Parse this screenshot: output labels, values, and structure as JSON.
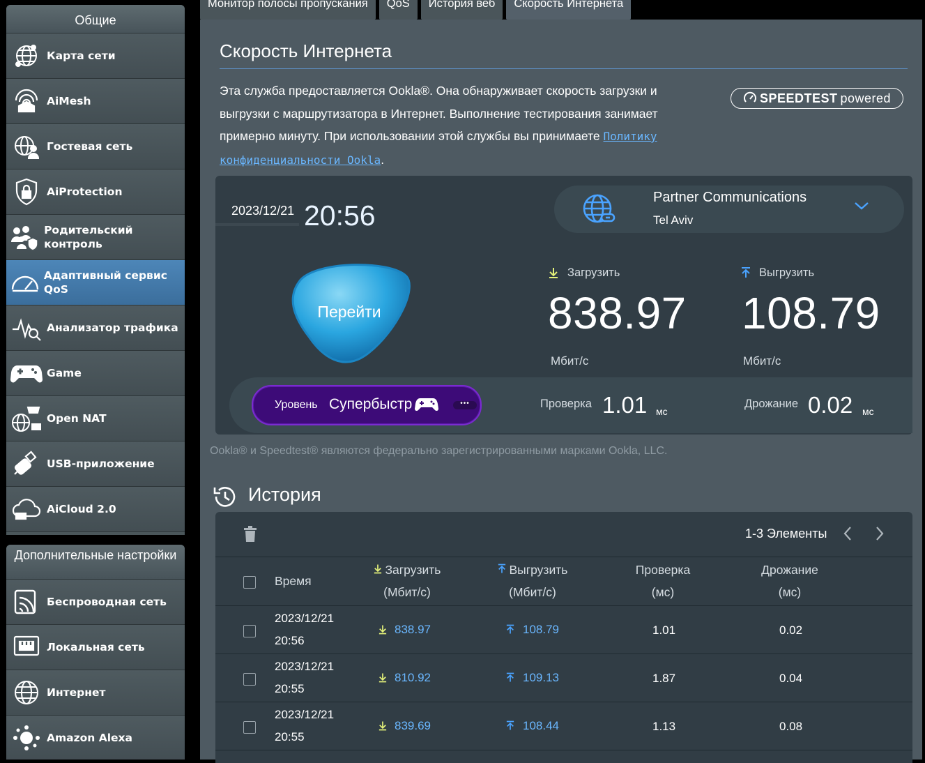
{
  "sidebar": {
    "general_title": "Общие",
    "general_items": [
      {
        "label": "Карта сети",
        "icon": "network-map-icon"
      },
      {
        "label": "AiMesh",
        "icon": "aimesh-icon"
      },
      {
        "label": "Гостевая сеть",
        "icon": "guest-network-icon"
      },
      {
        "label": "AiProtection",
        "icon": "shield-icon"
      },
      {
        "label": "Родительский контроль",
        "icon": "parental-control-icon"
      },
      {
        "label": "Адаптивный сервис QoS",
        "icon": "qos-gauge-icon"
      },
      {
        "label": "Анализатор трафика",
        "icon": "traffic-analyzer-icon"
      },
      {
        "label": "Game",
        "icon": "gamepad-icon"
      },
      {
        "label": "Open NAT",
        "icon": "open-nat-icon"
      },
      {
        "label": "USB-приложение",
        "icon": "usb-icon"
      },
      {
        "label": "AiCloud 2.0",
        "icon": "cloud-icon"
      }
    ],
    "advanced_title": "Дополнительные настройки",
    "advanced_items": [
      {
        "label": "Беспроводная сеть",
        "icon": "wireless-icon"
      },
      {
        "label": "Локальная сеть",
        "icon": "lan-icon"
      },
      {
        "label": "Интернет",
        "icon": "internet-globe-icon"
      },
      {
        "label": "Amazon Alexa",
        "icon": "alexa-icon"
      }
    ]
  },
  "tabs": [
    "Монитор полосы пропускания",
    "QoS",
    "История веб",
    "Скорость Интернета"
  ],
  "page": {
    "title": "Скорость Интернета",
    "intro_text": "Эта служба предоставляется Ookla®. Она обнаруживает скорость загрузки и выгрузки с маршрутизатора в Интернет. Выполнение тестирования занимает примерно минуту. При использовании этой службы вы принимаете ",
    "intro_link": "Политику конфиденциальности Ookla",
    "intro_end": ".",
    "badge_brand": "SPEEDTEST",
    "badge_suffix": "powered",
    "trademark": "Ookla® и Speedtest® являются федерально зарегистрированными марками Ookla, LLC."
  },
  "result": {
    "date": "2023/12/21",
    "time": "20:56",
    "isp_name": "Partner Communications",
    "isp_city": "Tel Aviv",
    "go_label": "Перейти",
    "download_label": "Загрузить",
    "download_value": "838.97",
    "download_unit": "Мбит/с",
    "upload_label": "Выгрузить",
    "upload_value": "108.79",
    "upload_unit": "Мбит/с",
    "level_label": "Уровень",
    "level_value": "Супербыстр",
    "ping_label": "Проверка",
    "ping_value": "1.01",
    "ping_unit": "мс",
    "jitter_label": "Дрожание",
    "jitter_value": "0.02",
    "jitter_unit": "мс",
    "accent_color": "#6ab7ff",
    "level_color": "#3d0b78"
  },
  "history": {
    "title": "История",
    "pager": "1-3 Элементы",
    "columns": {
      "time": "Время",
      "download": "Загрузить",
      "download_unit": "(Мбит/с)",
      "upload": "Выгрузить",
      "upload_unit": "(Мбит/с)",
      "ping": "Проверка",
      "ping_unit": "(мс)",
      "jitter": "Дрожание",
      "jitter_unit": "(мс)"
    },
    "rows": [
      {
        "date": "2023/12/21",
        "time": "20:56",
        "download": "838.97",
        "upload": "108.79",
        "ping": "1.01",
        "jitter": "0.02"
      },
      {
        "date": "2023/12/21",
        "time": "20:55",
        "download": "810.92",
        "upload": "109.13",
        "ping": "1.87",
        "jitter": "0.04"
      },
      {
        "date": "2023/12/21",
        "time": "20:55",
        "download": "839.69",
        "upload": "108.44",
        "ping": "1.13",
        "jitter": "0.08"
      }
    ]
  }
}
